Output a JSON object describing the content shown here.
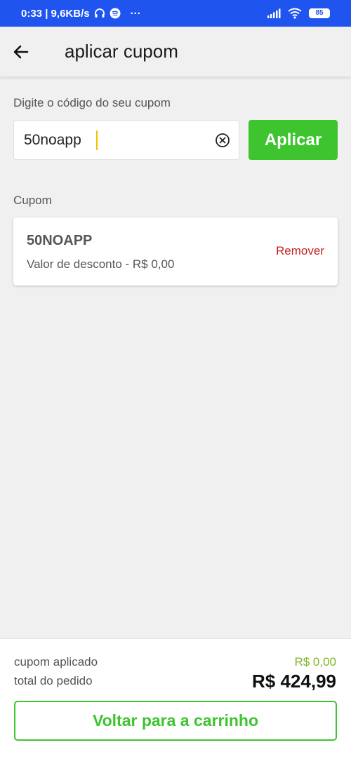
{
  "status_bar": {
    "time_and_speed": "0:33 | 9,6KB/s",
    "more": "···",
    "battery": "85"
  },
  "app_bar": {
    "title": "aplicar cupom"
  },
  "coupon_form": {
    "label": "Digite o código do seu cupom",
    "input_value": "50noapp",
    "apply_label": "Aplicar"
  },
  "coupon_section": {
    "label": "Cupom",
    "code": "50NOAPP",
    "discount_text": "Valor de desconto - R$ 0,00",
    "remove_label": "Remover"
  },
  "summary": {
    "applied_label": "cupom aplicado",
    "applied_value": "R$ 0,00",
    "total_label": "total do pedido",
    "total_value": "R$ 424,99",
    "back_button_label": "Voltar para a carrinho"
  },
  "colors": {
    "status_bar": "#1f54ee",
    "primary_green": "#3dc42f",
    "remove_red": "#c62020",
    "applied_value_green": "#7cb727"
  }
}
